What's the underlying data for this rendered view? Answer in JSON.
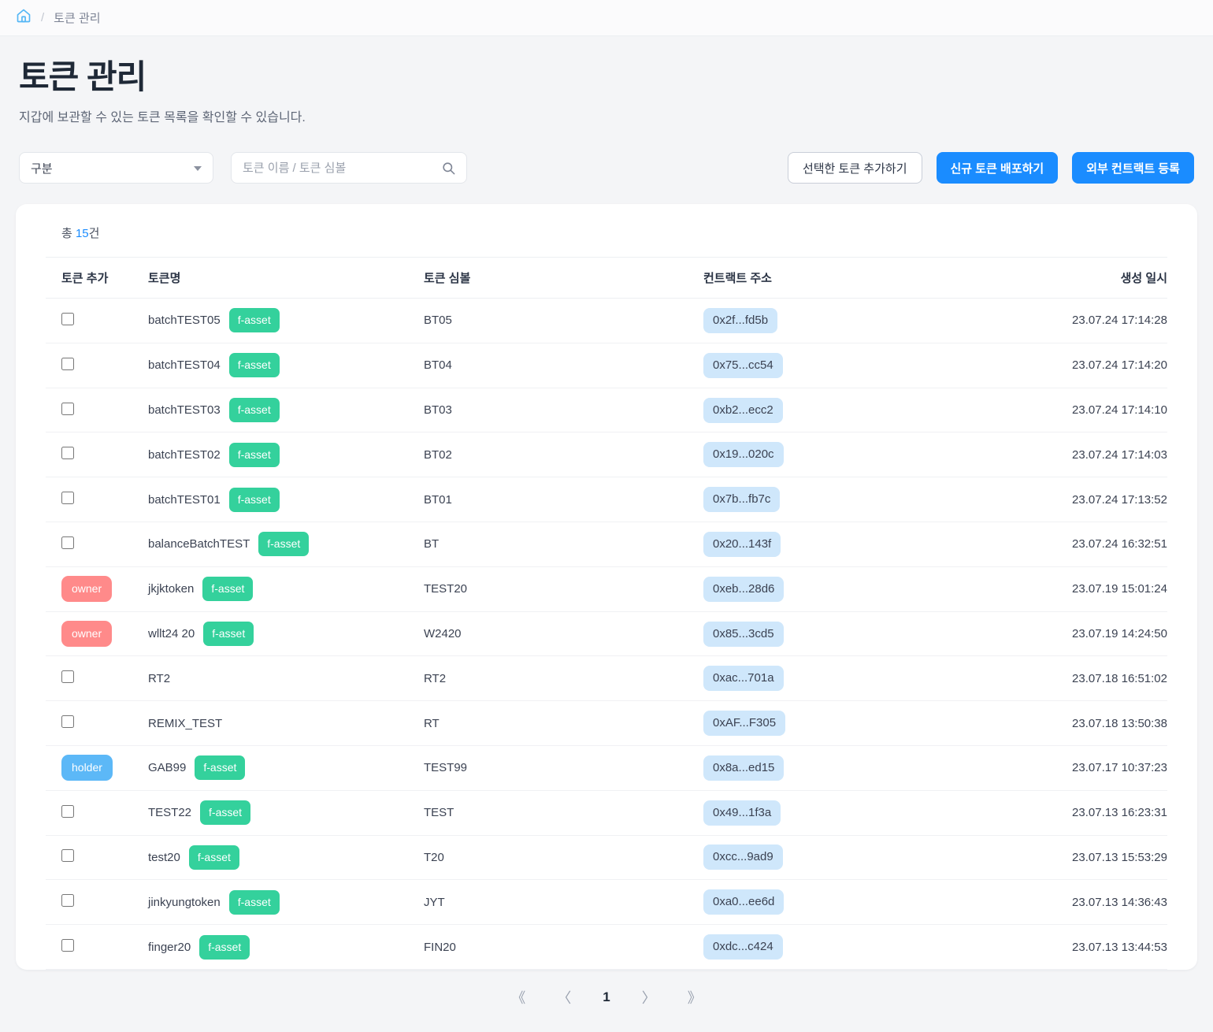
{
  "breadcrumb": {
    "home_icon": "home-icon",
    "separator": "/",
    "current": "토큰 관리"
  },
  "page": {
    "title": "토큰 관리",
    "subtitle": "지갑에 보관할 수 있는 토큰 목록을 확인할 수 있습니다."
  },
  "toolbar": {
    "filter_select_value": "구분",
    "search_placeholder": "토큰 이름 / 토큰 심볼",
    "search_value": "",
    "search_icon": "search-icon",
    "btn_add_selected": "선택한 토큰 추가하기",
    "btn_deploy_new": "신규 토큰 배포하기",
    "btn_register_external": "외부 컨트랙트 등록"
  },
  "table": {
    "total_prefix": "총 ",
    "total_count": "15",
    "total_suffix": "건",
    "headers": {
      "add": "토큰 추가",
      "name": "토큰명",
      "symbol": "토큰 심볼",
      "address": "컨트랙트 주소",
      "created": "생성 일시"
    },
    "rows": [
      {
        "add_type": "checkbox",
        "add_label": "",
        "name": "batchTEST05",
        "tag": "f-asset",
        "symbol": "BT05",
        "address": "0x2f...fd5b",
        "created": "23.07.24 17:14:28"
      },
      {
        "add_type": "checkbox",
        "add_label": "",
        "name": "batchTEST04",
        "tag": "f-asset",
        "symbol": "BT04",
        "address": "0x75...cc54",
        "created": "23.07.24 17:14:20"
      },
      {
        "add_type": "checkbox",
        "add_label": "",
        "name": "batchTEST03",
        "tag": "f-asset",
        "symbol": "BT03",
        "address": "0xb2...ecc2",
        "created": "23.07.24 17:14:10"
      },
      {
        "add_type": "checkbox",
        "add_label": "",
        "name": "batchTEST02",
        "tag": "f-asset",
        "symbol": "BT02",
        "address": "0x19...020c",
        "created": "23.07.24 17:14:03"
      },
      {
        "add_type": "checkbox",
        "add_label": "",
        "name": "batchTEST01",
        "tag": "f-asset",
        "symbol": "BT01",
        "address": "0x7b...fb7c",
        "created": "23.07.24 17:13:52"
      },
      {
        "add_type": "checkbox",
        "add_label": "",
        "name": "balanceBatchTEST",
        "tag": "f-asset",
        "symbol": "BT",
        "address": "0x20...143f",
        "created": "23.07.24 16:32:51"
      },
      {
        "add_type": "owner",
        "add_label": "owner",
        "name": "jkjktoken",
        "tag": "f-asset",
        "symbol": "TEST20",
        "address": "0xeb...28d6",
        "created": "23.07.19 15:01:24"
      },
      {
        "add_type": "owner",
        "add_label": "owner",
        "name": "wllt24 20",
        "tag": "f-asset",
        "symbol": "W2420",
        "address": "0x85...3cd5",
        "created": "23.07.19 14:24:50"
      },
      {
        "add_type": "checkbox",
        "add_label": "",
        "name": "RT2",
        "tag": "",
        "symbol": "RT2",
        "address": "0xac...701a",
        "created": "23.07.18 16:51:02"
      },
      {
        "add_type": "checkbox",
        "add_label": "",
        "name": "REMIX_TEST",
        "tag": "",
        "symbol": "RT",
        "address": "0xAF...F305",
        "created": "23.07.18 13:50:38"
      },
      {
        "add_type": "holder",
        "add_label": "holder",
        "name": "GAB99",
        "tag": "f-asset",
        "symbol": "TEST99",
        "address": "0x8a...ed15",
        "created": "23.07.17 10:37:23"
      },
      {
        "add_type": "checkbox",
        "add_label": "",
        "name": "TEST22",
        "tag": "f-asset",
        "symbol": "TEST",
        "address": "0x49...1f3a",
        "created": "23.07.13 16:23:31"
      },
      {
        "add_type": "checkbox",
        "add_label": "",
        "name": "test20",
        "tag": "f-asset",
        "symbol": "T20",
        "address": "0xcc...9ad9",
        "created": "23.07.13 15:53:29"
      },
      {
        "add_type": "checkbox",
        "add_label": "",
        "name": "jinkyungtoken",
        "tag": "f-asset",
        "symbol": "JYT",
        "address": "0xa0...ee6d",
        "created": "23.07.13 14:36:43"
      },
      {
        "add_type": "checkbox",
        "add_label": "",
        "name": "finger20",
        "tag": "f-asset",
        "symbol": "FIN20",
        "address": "0xdc...c424",
        "created": "23.07.13 13:44:53"
      }
    ]
  },
  "pagination": {
    "first": "《",
    "prev": "〈",
    "current_page": "1",
    "next": "〉",
    "last": "》"
  },
  "colors": {
    "accent": "#1a8cff",
    "tag_fasset": "#34d19c",
    "badge_owner": "#ff8a8a",
    "badge_holder": "#5cb8f7",
    "address_chip": "#cfe7fb",
    "page_bg": "#f4f5f7"
  }
}
